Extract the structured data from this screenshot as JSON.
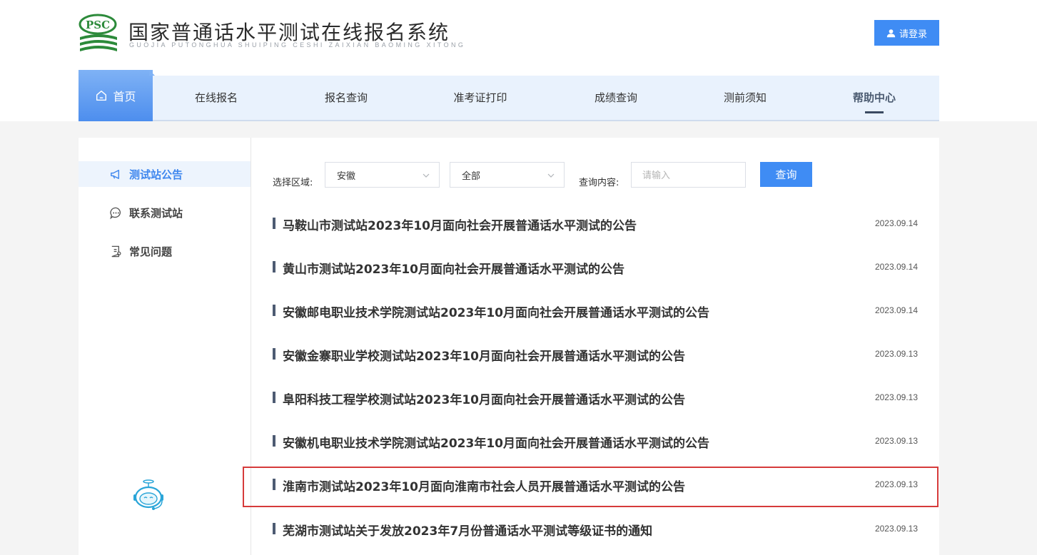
{
  "header": {
    "logo_text": "PSC",
    "title": "国家普通话水平测试在线报名系统",
    "subtitle": "GUOJIA PUTONGHUA SHUIPING CESHI ZAIXIAN BAOMING XITONG",
    "login_label": "请登录",
    "colors": {
      "accent": "#3f8cf4",
      "logo_green": "#2c8a3a"
    }
  },
  "nav": {
    "home": "首页",
    "items": [
      "在线报名",
      "报名查询",
      "准考证打印",
      "成绩查询",
      "测前须知",
      "帮助中心"
    ],
    "active": "帮助中心"
  },
  "sidebar": {
    "items": [
      {
        "label": "测试站公告",
        "icon": "megaphone-icon",
        "active": true
      },
      {
        "label": "联系测试站",
        "icon": "chat-icon",
        "active": false
      },
      {
        "label": "常见问题",
        "icon": "document-icon",
        "active": false
      }
    ],
    "assistant_icon": "robot-icon"
  },
  "filters": {
    "region_label": "选择区域:",
    "province": "安徽",
    "city": "全部",
    "query_label": "查询内容:",
    "query_placeholder": "请输入",
    "query_value": "",
    "query_button": "查询"
  },
  "announcements": [
    {
      "title": "马鞍山市测试站2023年10月面向社会开展普通话水平测试的公告",
      "date": "2023.09.14"
    },
    {
      "title": "黄山市测试站2023年10月面向社会开展普通话水平测试的公告",
      "date": "2023.09.14"
    },
    {
      "title": "安徽邮电职业技术学院测试站2023年10月面向社会开展普通话水平测试的公告",
      "date": "2023.09.14"
    },
    {
      "title": "安徽金寨职业学校测试站2023年10月面向社会开展普通话水平测试的公告",
      "date": "2023.09.13"
    },
    {
      "title": "阜阳科技工程学校测试站2023年10月面向社会开展普通话水平测试的公告",
      "date": "2023.09.13"
    },
    {
      "title": "安徽机电职业技术学院测试站2023年10月面向社会开展普通话水平测试的公告",
      "date": "2023.09.13"
    },
    {
      "title": "淮南市测试站2023年10月面向淮南市社会人员开展普通话水平测试的公告",
      "date": "2023.09.13",
      "highlighted": true
    },
    {
      "title": "芜湖市测试站关于发放2023年7月份普通话水平测试等级证书的通知",
      "date": "2023.09.13"
    }
  ]
}
